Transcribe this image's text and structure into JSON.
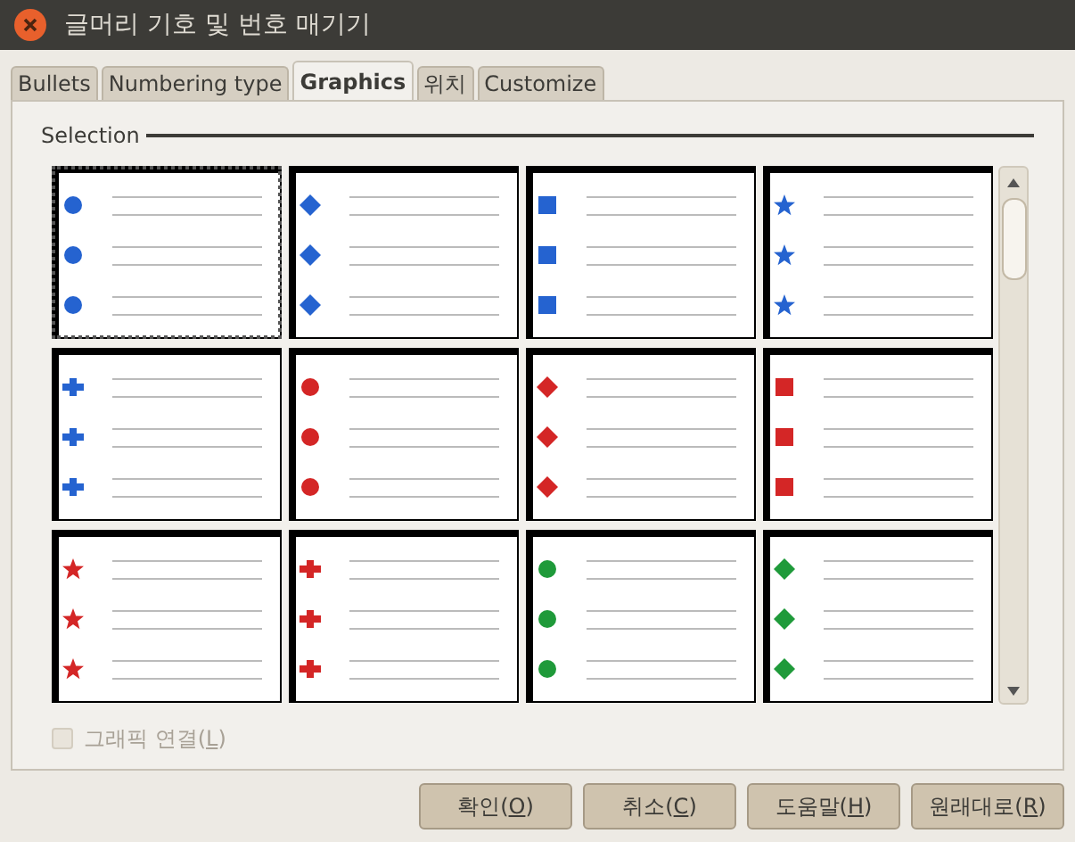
{
  "window": {
    "title": "글머리 기호 및 번호 매기기"
  },
  "tabs": [
    {
      "label": "Bullets",
      "selected": false
    },
    {
      "label": "Numbering type",
      "selected": false
    },
    {
      "label": "Graphics",
      "selected": true
    },
    {
      "label": "위치",
      "selected": false
    },
    {
      "label": "Customize",
      "selected": false
    }
  ],
  "selection": {
    "title": "Selection",
    "cells": [
      {
        "kind": "sphere",
        "color": "#2563d0",
        "selected": true
      },
      {
        "kind": "diamond",
        "color": "#2563d0",
        "selected": false
      },
      {
        "kind": "square",
        "color": "#2563d0",
        "selected": false
      },
      {
        "kind": "star",
        "color": "#2563d0",
        "selected": false
      },
      {
        "kind": "cross",
        "color": "#2563d0",
        "selected": false
      },
      {
        "kind": "sphere",
        "color": "#d42626",
        "selected": false
      },
      {
        "kind": "diamond",
        "color": "#d42626",
        "selected": false
      },
      {
        "kind": "square",
        "color": "#d42626",
        "selected": false
      },
      {
        "kind": "star",
        "color": "#d42626",
        "selected": false
      },
      {
        "kind": "cross",
        "color": "#d42626",
        "selected": false
      },
      {
        "kind": "sphere",
        "color": "#1f9a3a",
        "selected": false
      },
      {
        "kind": "diamond",
        "color": "#1f9a3a",
        "selected": false
      }
    ]
  },
  "link_graphics": {
    "label": "그래픽 연결(L)",
    "checked": false,
    "disabled": true
  },
  "buttons": [
    {
      "label": "확인(O)"
    },
    {
      "label": "취소(C)"
    },
    {
      "label": "도움말(H)"
    },
    {
      "label": "원래대로(R)"
    }
  ]
}
